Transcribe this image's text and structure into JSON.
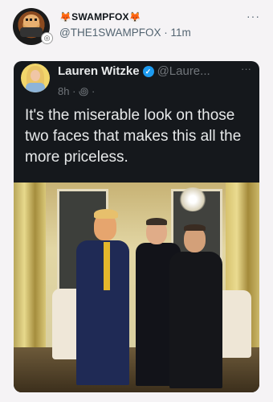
{
  "outer_post": {
    "display_name": "SWAMPFOX",
    "name_emoji_left": "🦊",
    "name_emoji_right": "🦊",
    "handle": "@THE1SWAMPFOX",
    "separator": "·",
    "time": "11m",
    "more": "···"
  },
  "quoted_post": {
    "display_name": "Lauren Witzke",
    "verified_glyph": "✓",
    "handle": "@Laure...",
    "time": "8h · ꩜ ·",
    "more": "···",
    "text": "It's the miserable look on those two faces that makes this all the more priceless."
  },
  "colors": {
    "background": "#f5f3f5",
    "card": "#15181c",
    "verified": "#1d9bf0"
  }
}
